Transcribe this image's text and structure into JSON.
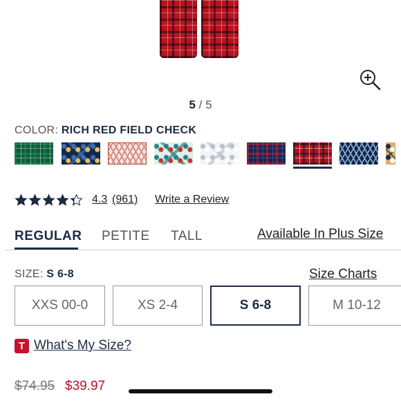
{
  "gallery": {
    "current": "5",
    "separator": "/",
    "total": "5",
    "zoom_icon": "zoom-in-icon"
  },
  "color": {
    "label": "COLOR:",
    "selected": "RICH RED FIELD CHECK",
    "swatches": [
      {
        "pattern": "green plaid",
        "colors": [
          "#0f5a3a",
          "#1f8a55",
          "#c9e6d4"
        ]
      },
      {
        "pattern": "navy print",
        "colors": [
          "#14284d",
          "#3f6fb5",
          "#e3c35a"
        ]
      },
      {
        "pattern": "pink zigzag",
        "colors": [
          "#f6e3e3",
          "#d98a8a",
          "#b0542a"
        ]
      },
      {
        "pattern": "mint critter print",
        "colors": [
          "#d9f1ec",
          "#2f7d86",
          "#c0392b"
        ]
      },
      {
        "pattern": "light geometric",
        "colors": [
          "#f3f4f6",
          "#b6c2cc",
          "#ffffff"
        ]
      },
      {
        "pattern": "navy red plaid",
        "colors": [
          "#1b2550",
          "#c32030",
          "#3b6db0"
        ]
      },
      {
        "pattern": "rich red field check",
        "colors": [
          "#b3121e",
          "#1a1a2a",
          "#ffffff"
        ]
      },
      {
        "pattern": "navy ikat",
        "colors": [
          "#16244a",
          "#6da5d6",
          "#e7eef5"
        ]
      },
      {
        "pattern": "partial",
        "colors": [
          "#e0b070",
          "#1c2b45",
          "#ffffff"
        ]
      }
    ]
  },
  "rating": {
    "value": "4.3",
    "count": "(961)",
    "stars_filled": 4.3,
    "stars_total": 5,
    "write_review": "Write a Review"
  },
  "fit_tabs": [
    {
      "label": "REGULAR",
      "active": true
    },
    {
      "label": "PETITE",
      "active": false
    },
    {
      "label": "TALL",
      "active": false
    }
  ],
  "plus_size_link": "Available In Plus Size",
  "size": {
    "label": "SIZE:",
    "selected": "S 6-8",
    "charts_link": "Size Charts",
    "options": [
      "XXS 00-0",
      "XS 2-4",
      "S 6-8",
      "M 10-12"
    ]
  },
  "true_fit": {
    "badge": "T",
    "link": "What's My Size?"
  },
  "price": {
    "original": "$74.95",
    "sale": "$39.97"
  },
  "colors": {
    "brand_navy": "#1c2b45",
    "sale_red": "#b0122b",
    "badge_red": "#c8102e"
  }
}
